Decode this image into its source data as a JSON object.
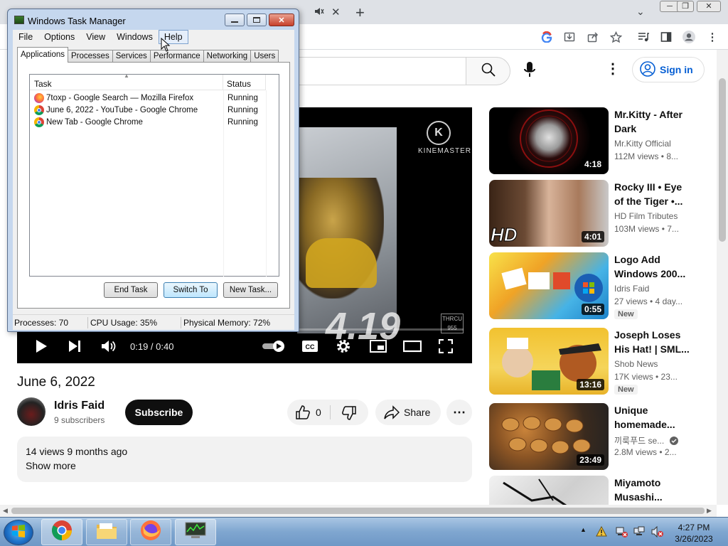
{
  "browser": {
    "new_tab_symbol": "+",
    "tab_close_symbol": "✕",
    "tabs_menu_symbol": "⌄",
    "window_buttons": [
      "─",
      "❐",
      "✕"
    ]
  },
  "youtube": {
    "signin_label": "Sign in",
    "player": {
      "time": "0:19 / 0:40",
      "progress_fraction": 0.475,
      "overlay_text": "4.19",
      "brand_letter": "K",
      "brand_text": "KINEMASTER",
      "watermark_text": "THRCU 955"
    },
    "video_title": "June 6, 2022",
    "channel": {
      "name": "Idris Faid",
      "subscribers": "9 subscribers"
    },
    "subscribe_label": "Subscribe",
    "like_count": "0",
    "share_label": "Share",
    "description": {
      "meta": "14 views  9 months ago",
      "show_more": "Show more"
    },
    "suggestions": [
      {
        "title": "Mr.Kitty - After Dark",
        "channel": "Mr.Kitty Official",
        "views": "112M views  • 8...",
        "duration": "4:18",
        "badge": ""
      },
      {
        "title": "Rocky III • Eye of the Tiger •...",
        "channel": "HD Film Tributes",
        "views": "103M views  • 7...",
        "duration": "4:01",
        "badge": ""
      },
      {
        "title": "Logo Add Windows 200...",
        "channel": "Idris Faid",
        "views": "27 views  • 4 day...",
        "duration": "0:55",
        "badge": "New"
      },
      {
        "title": "Joseph Loses His Hat! | SML...",
        "channel": "Shob News",
        "views": "17K views  • 23...",
        "duration": "13:16",
        "badge": "New"
      },
      {
        "title": "Unique homemade...",
        "channel": "끼룩푸드 se...",
        "views": "2.8M views  • 2...",
        "duration": "23:49",
        "badge": ""
      },
      {
        "title": "Miyamoto Musashi...",
        "channel": "",
        "views": "",
        "duration": "",
        "badge": ""
      }
    ]
  },
  "taskmanager": {
    "title": "Windows Task Manager",
    "menu": [
      "File",
      "Options",
      "View",
      "Windows",
      "Help"
    ],
    "tabs": [
      "Applications",
      "Processes",
      "Services",
      "Performance",
      "Networking",
      "Users"
    ],
    "columns": {
      "task": "Task",
      "status": "Status"
    },
    "rows": [
      {
        "task": "7toxp - Google Search — Mozilla Firefox",
        "status": "Running",
        "app": "firefox"
      },
      {
        "task": "June 6, 2022 - YouTube - Google Chrome",
        "status": "Running",
        "app": "chrome"
      },
      {
        "task": "New Tab - Google Chrome",
        "status": "Running",
        "app": "chrome"
      }
    ],
    "buttons": {
      "end_task": "End Task",
      "switch_to": "Switch To",
      "new_task": "New Task..."
    },
    "status": {
      "processes": "Processes: 70",
      "cpu": "CPU Usage: 35%",
      "memory": "Physical Memory: 72%"
    }
  },
  "taskbar": {
    "clock_time": "4:27 PM",
    "clock_date": "3/26/2023",
    "tray_arrow": "▲"
  },
  "colors": {
    "yt_red": "#ff0000",
    "yt_blue": "#065fd4",
    "win7_taskbar": "#7fa6d0"
  }
}
